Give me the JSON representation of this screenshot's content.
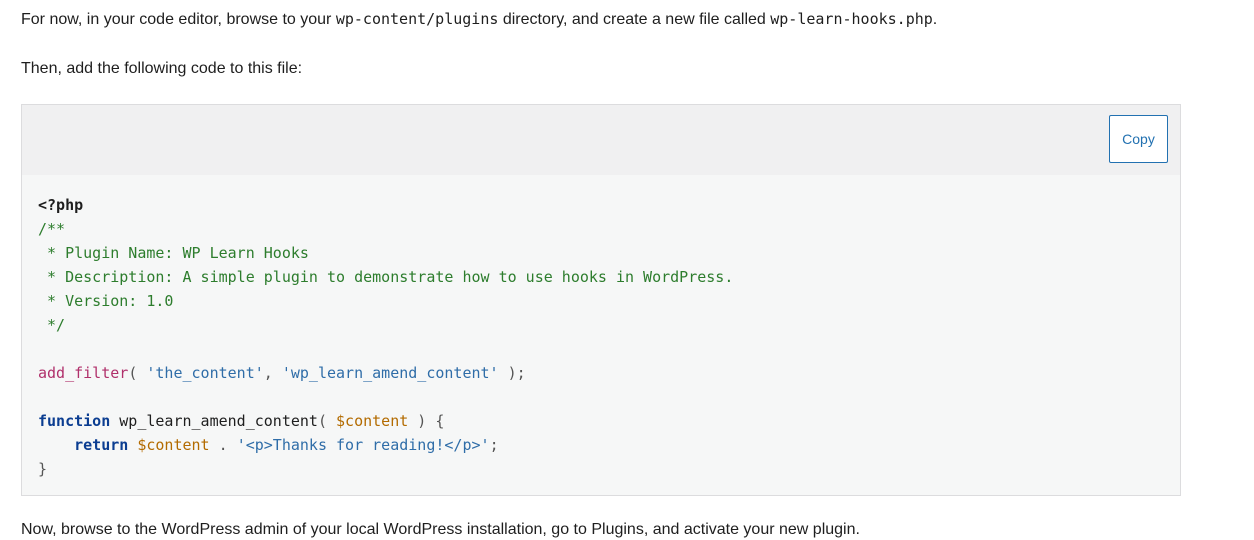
{
  "intro": {
    "line1": {
      "part1": "For now, in your code editor, browse to your ",
      "code1": "wp-content/plugins",
      "part2": " directory, and create a new file called ",
      "code2": "wp-learn-hooks.php",
      "part3": "."
    },
    "line2": "Then, add the following code to this file:"
  },
  "code_block": {
    "copy_label": "Copy",
    "lines": [
      [
        {
          "t": "<?php",
          "c": "tag"
        }
      ],
      [
        {
          "t": "/**",
          "c": "comment"
        }
      ],
      [
        {
          "t": " * Plugin Name: WP Learn Hooks",
          "c": "comment"
        }
      ],
      [
        {
          "t": " * Description: A simple plugin to demonstrate how to use hooks in WordPress.",
          "c": "comment"
        }
      ],
      [
        {
          "t": " * Version: 1.0",
          "c": "comment"
        }
      ],
      [
        {
          "t": " */",
          "c": "comment"
        }
      ],
      [],
      [
        {
          "t": "add_filter",
          "c": "fn"
        },
        {
          "t": "( ",
          "c": "punct"
        },
        {
          "t": "'the_content'",
          "c": "str"
        },
        {
          "t": ", ",
          "c": "punct"
        },
        {
          "t": "'wp_learn_amend_content'",
          "c": "str"
        },
        {
          "t": " );",
          "c": "punct"
        }
      ],
      [],
      [
        {
          "t": "function",
          "c": "kw"
        },
        {
          "t": " wp_learn_amend_content",
          "c": "plain"
        },
        {
          "t": "( ",
          "c": "punct"
        },
        {
          "t": "$content",
          "c": "var"
        },
        {
          "t": " ) {",
          "c": "punct"
        }
      ],
      [
        {
          "t": "    ",
          "c": "plain"
        },
        {
          "t": "return",
          "c": "kw"
        },
        {
          "t": " ",
          "c": "plain"
        },
        {
          "t": "$content",
          "c": "var"
        },
        {
          "t": " . ",
          "c": "punct"
        },
        {
          "t": "'<p>Thanks for reading!</p>'",
          "c": "str"
        },
        {
          "t": ";",
          "c": "punct"
        }
      ],
      [
        {
          "t": "}",
          "c": "punct"
        }
      ]
    ]
  },
  "outro": "Now, browse to the WordPress admin of your local WordPress installation, go to Plugins, and activate your new plugin."
}
